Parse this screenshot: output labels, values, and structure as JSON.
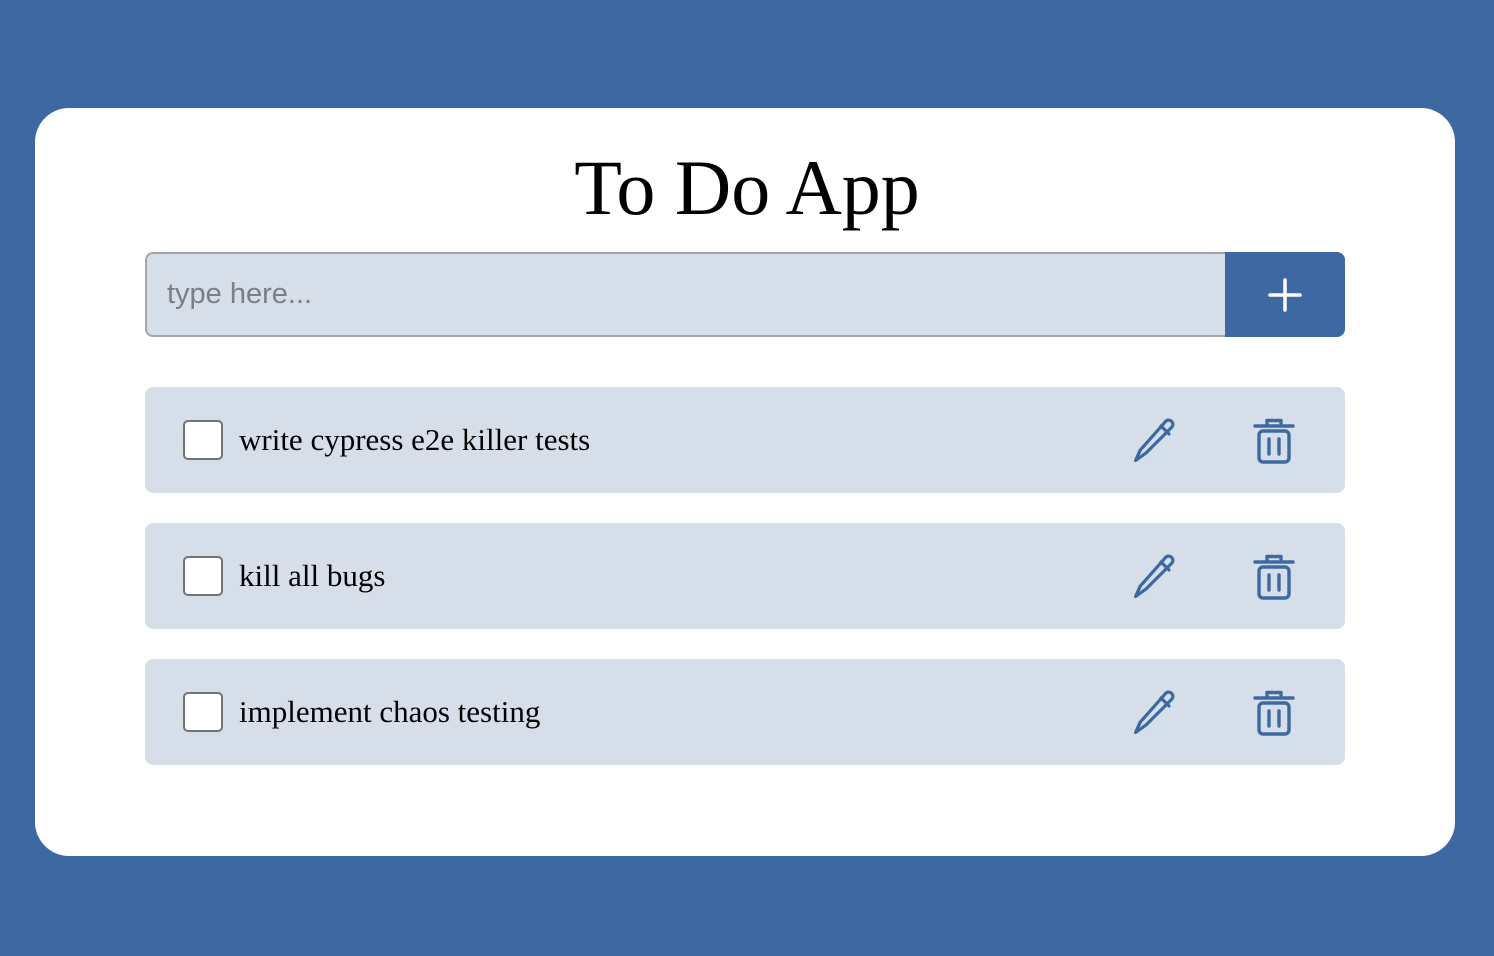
{
  "app": {
    "title": "To Do App"
  },
  "new_task": {
    "placeholder": "type here...",
    "value": "",
    "add_icon": "plus-icon"
  },
  "todos": [
    {
      "text": "write cypress e2e killer tests",
      "done": false,
      "edit_icon": "pencil-icon",
      "delete_icon": "trash-icon"
    },
    {
      "text": "kill all bugs",
      "done": false,
      "edit_icon": "pencil-icon",
      "delete_icon": "trash-icon"
    },
    {
      "text": "implement chaos testing",
      "done": false,
      "edit_icon": "pencil-icon",
      "delete_icon": "trash-icon"
    }
  ],
  "colors": {
    "background": "#3d68a1",
    "card": "#ffffff",
    "item_background": "#d6deea",
    "accent": "#3d68a1"
  }
}
